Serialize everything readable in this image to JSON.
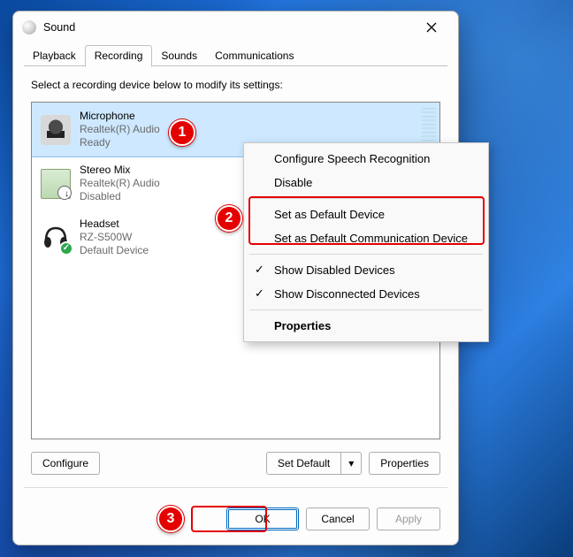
{
  "window": {
    "title": "Sound"
  },
  "tabs": [
    {
      "label": "Playback"
    },
    {
      "label": "Recording"
    },
    {
      "label": "Sounds"
    },
    {
      "label": "Communications"
    }
  ],
  "active_tab_index": 1,
  "instruction": "Select a recording device below to modify its settings:",
  "devices": [
    {
      "name": "Microphone",
      "driver": "Realtek(R) Audio",
      "status": "Ready",
      "selected": true,
      "icon": "microphone-icon"
    },
    {
      "name": "Stereo Mix",
      "driver": "Realtek(R) Audio",
      "status": "Disabled",
      "selected": false,
      "icon": "sound-card-icon",
      "overlay": "download"
    },
    {
      "name": "Headset",
      "driver": "RZ-S500W",
      "status": "Default Device",
      "selected": false,
      "icon": "headset-icon",
      "overlay": "check"
    }
  ],
  "buttons": {
    "configure": "Configure",
    "set_default": "Set Default",
    "properties": "Properties",
    "ok": "OK",
    "cancel": "Cancel",
    "apply": "Apply"
  },
  "context_menu": {
    "items": [
      {
        "label": "Configure Speech Recognition",
        "checked": false
      },
      {
        "label": "Disable",
        "checked": false
      },
      {
        "sep": true
      },
      {
        "label": "Set as Default Device",
        "checked": false,
        "hl": true
      },
      {
        "label": "Set as Default Communication Device",
        "checked": false,
        "hl": true
      },
      {
        "sep": true
      },
      {
        "label": "Show Disabled Devices",
        "checked": true
      },
      {
        "label": "Show Disconnected Devices",
        "checked": true
      },
      {
        "sep": true
      },
      {
        "label": "Properties",
        "checked": false,
        "bold": true
      }
    ]
  },
  "callouts": {
    "c1": "1",
    "c2": "2",
    "c3": "3"
  }
}
